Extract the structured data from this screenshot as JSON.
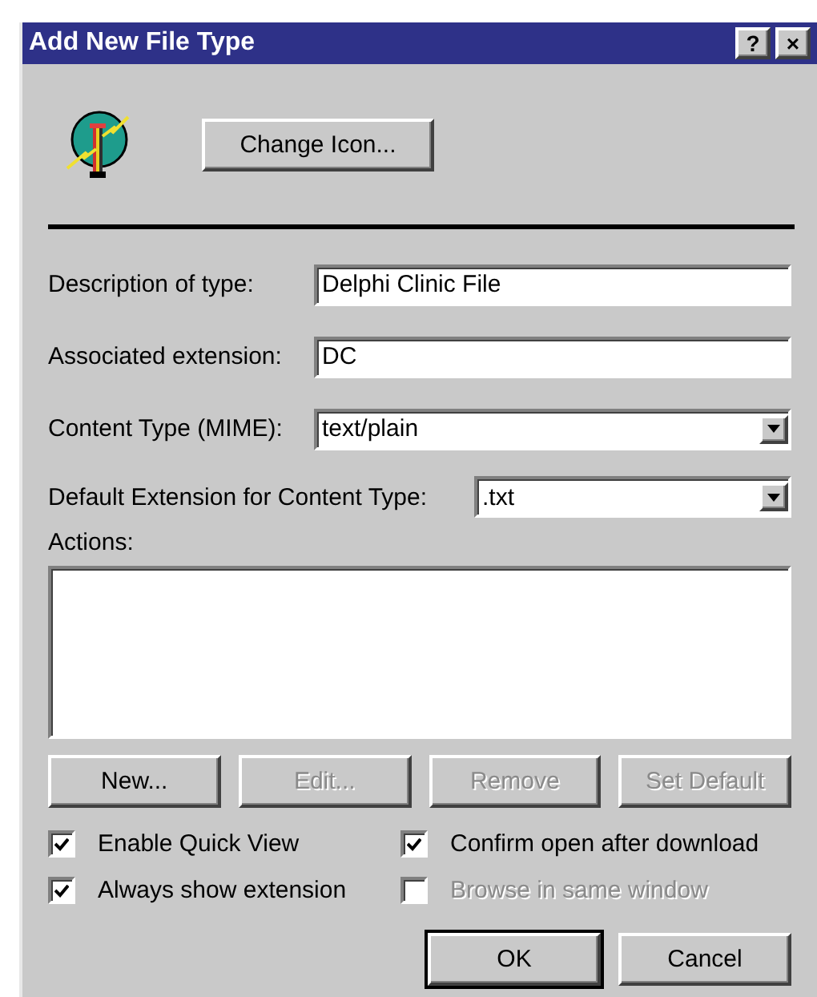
{
  "window": {
    "title": "Add New File Type",
    "title_buttons": [
      "?",
      "×"
    ]
  },
  "change_icon_button": {
    "label": "Change Icon..."
  },
  "fields": [
    {
      "kind": "text",
      "label": "Description of type:",
      "value": "Delphi Clinic File"
    },
    {
      "kind": "text",
      "label": "Associated extension:",
      "value": "DC"
    },
    {
      "kind": "combo",
      "label": "Content Type (MIME):",
      "value": "text/plain"
    }
  ],
  "default_extension": {
    "label": "Default Extension for Content Type:",
    "value": ".txt"
  },
  "actions": {
    "label": "Actions:"
  },
  "action_buttons": [
    {
      "label": "New...",
      "disabled": false
    },
    {
      "label": "Edit...",
      "disabled": true
    },
    {
      "label": "Remove",
      "disabled": true
    },
    {
      "label": "Set Default",
      "disabled": true
    }
  ],
  "checkboxes": [
    {
      "label": "Enable Quick View",
      "checked": true,
      "disabled": false
    },
    {
      "label": "Confirm open after download",
      "checked": true,
      "disabled": false
    },
    {
      "label": "Always show extension",
      "checked": true,
      "disabled": false
    },
    {
      "label": "Browse in same window",
      "checked": false,
      "disabled": true
    }
  ],
  "dialog_buttons": [
    {
      "label": "OK",
      "selected": true
    },
    {
      "label": "Cancel",
      "selected": false
    }
  ]
}
